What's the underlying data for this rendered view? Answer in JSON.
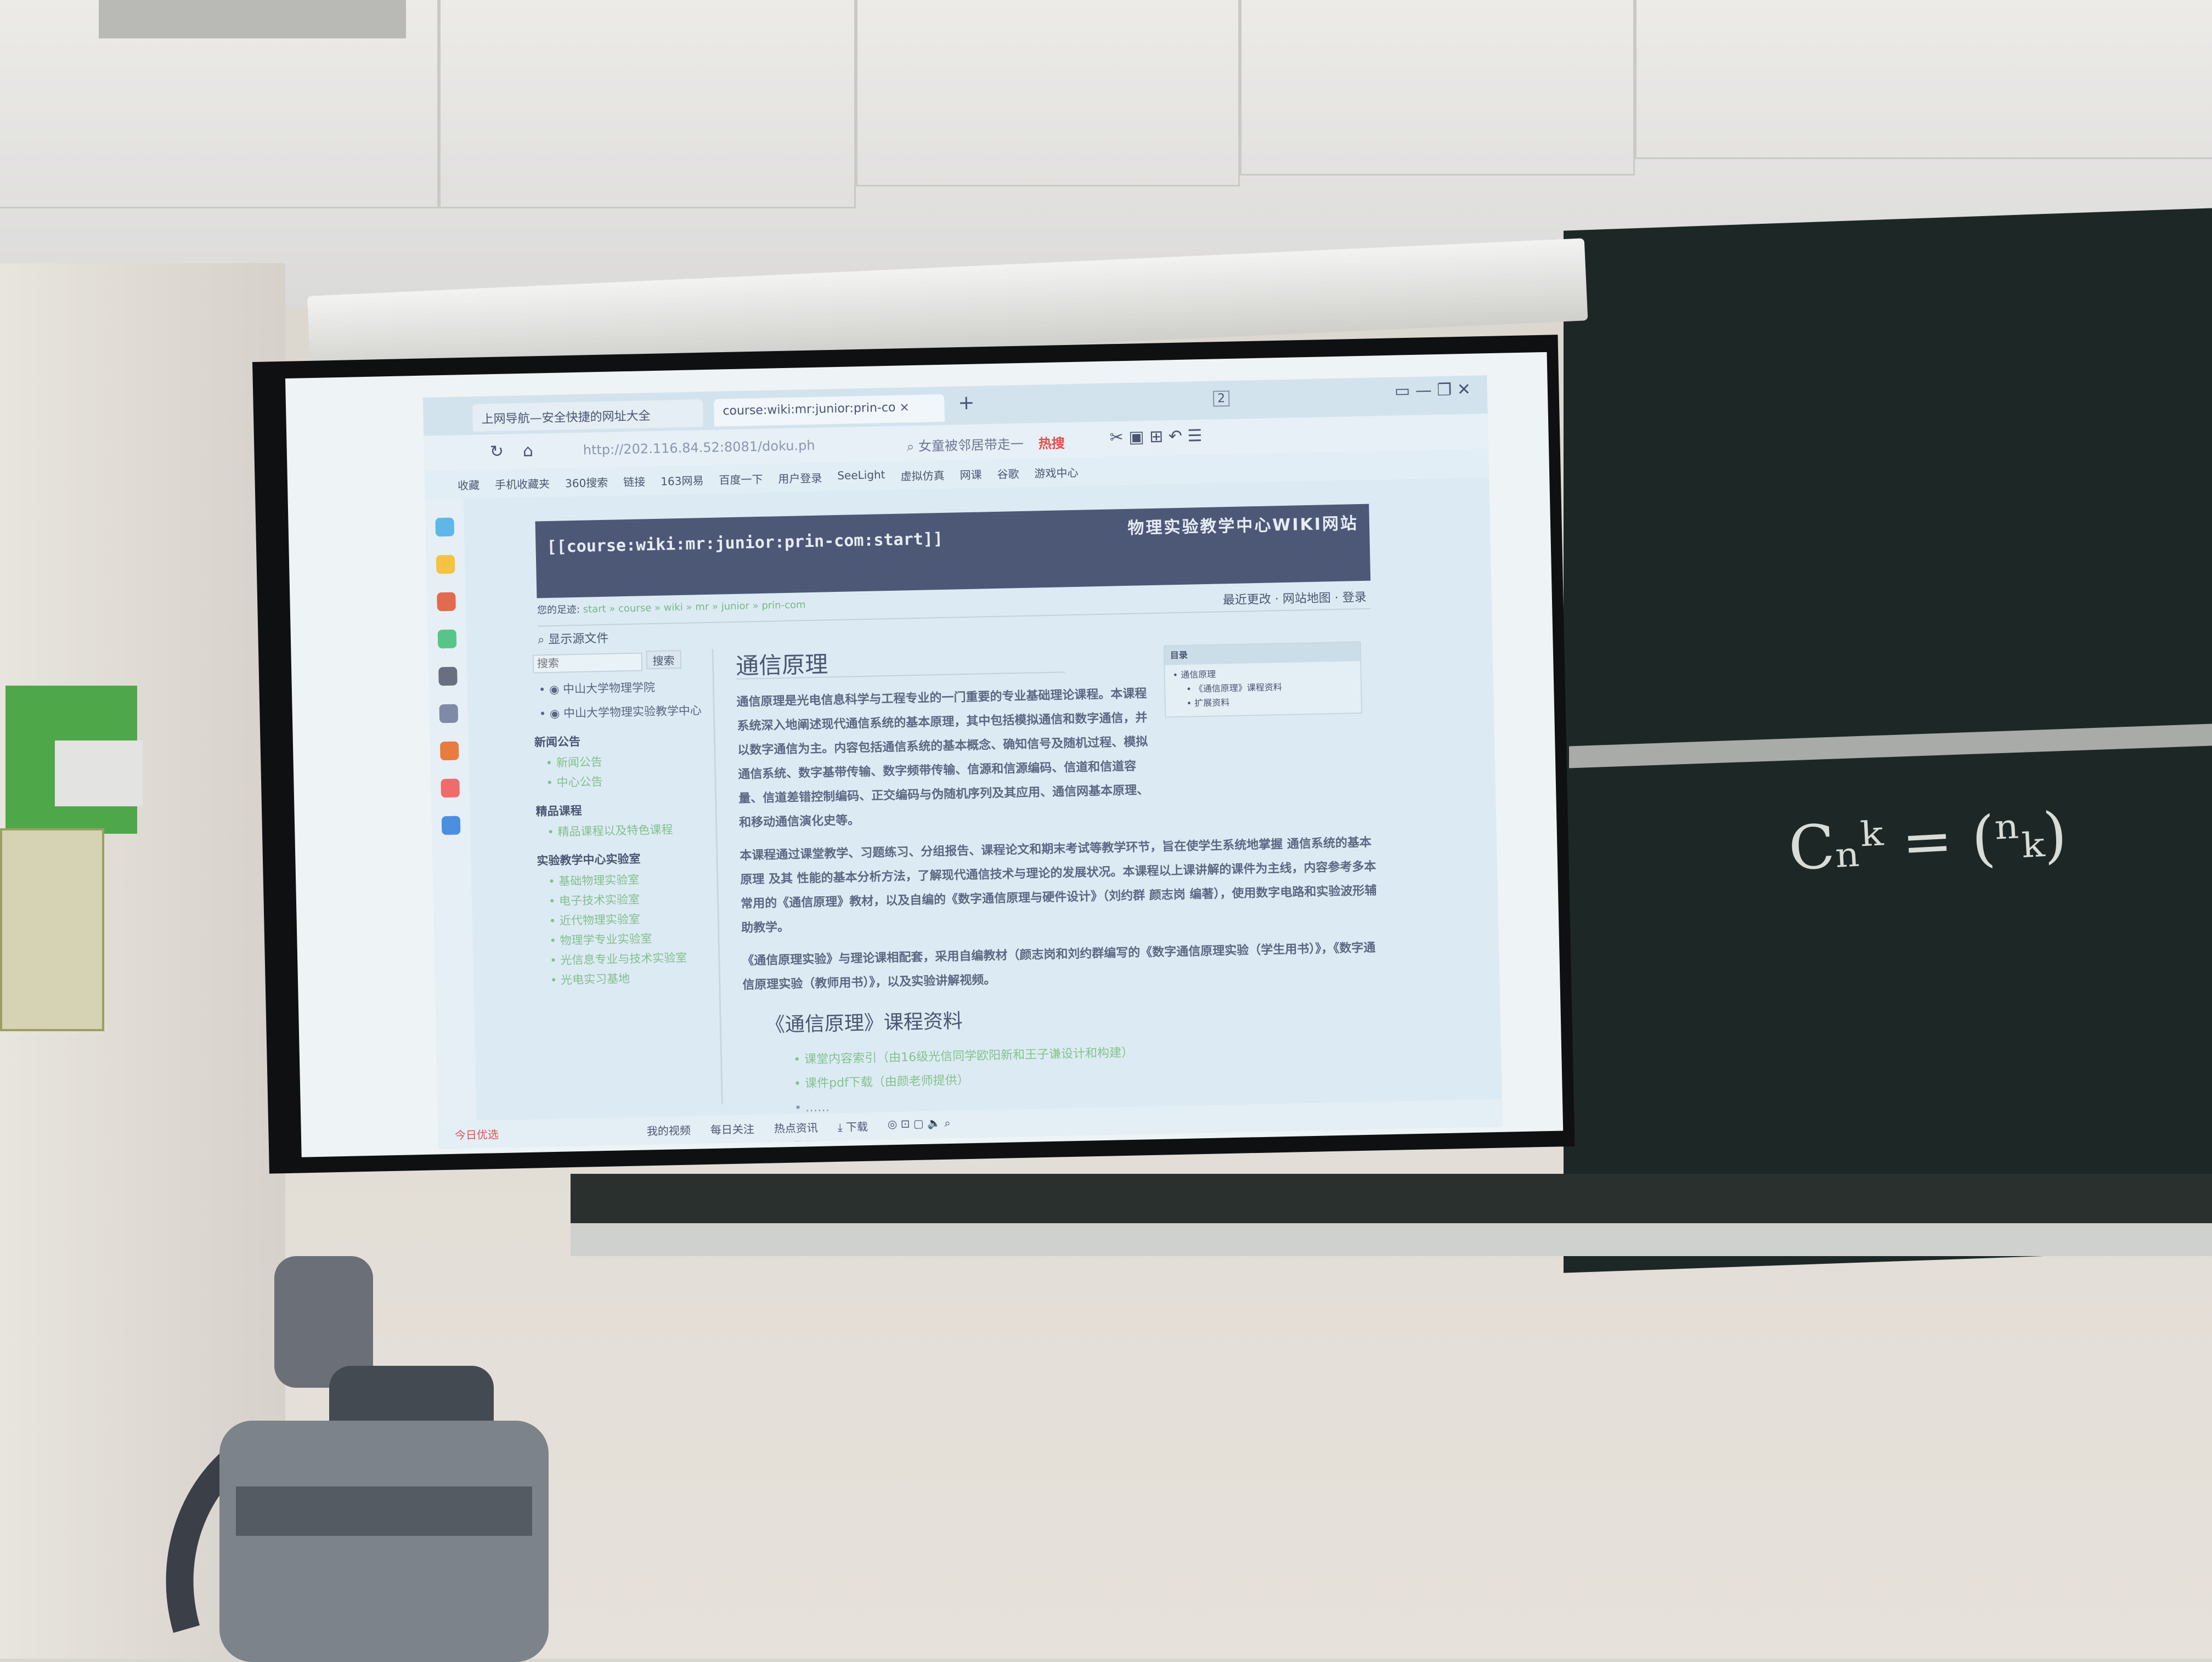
{
  "browser": {
    "tabs": [
      {
        "label": "上网导航—安全快捷的网址大全"
      },
      {
        "label": "course:wiki:mr:junior:prin-co"
      }
    ],
    "new_tab": "+",
    "close_tab": "×",
    "url": "http://202.116.84.52:8081/doku.ph",
    "search_hint": "女童被邻居带走一",
    "hot_label": "热搜",
    "page_counter": "2",
    "bookmarks": [
      "收藏",
      "手机收藏夹",
      "360搜索",
      "链接",
      "163网易",
      "百度一下",
      "用户登录",
      "SeeLight",
      "虚拟仿真",
      "网课",
      "谷歌",
      "游戏中心"
    ]
  },
  "page": {
    "banner_id": "[[course:wiki:mr:junior:prin-com:start]]",
    "banner_site": "物理实验教学中心WIKI网站",
    "breadcrumb_label": "您的足迹:",
    "breadcrumb": "start » course » wiki » mr » junior » prin-com",
    "tools": {
      "recent": "最近更改",
      "sitemap": "网站地图",
      "login": "登录"
    },
    "show_source": "显示源文件",
    "search": {
      "placeholder": "搜索",
      "button": "搜索"
    },
    "nav": {
      "links": [
        "中山大学物理学院",
        "中山大学物理实验教学中心"
      ],
      "sections": [
        {
          "title": "新闻公告",
          "items": [
            "新闻公告",
            "中心公告"
          ]
        },
        {
          "title": "精品课程",
          "items": [
            "精品课程以及特色课程"
          ]
        },
        {
          "title": "实验教学中心实验室",
          "items": [
            "基础物理实验室",
            "电子技术实验室",
            "近代物理实验室",
            "物理学专业实验室",
            "光信息专业与技术实验室",
            "光电实习基地"
          ]
        }
      ]
    },
    "title": "通信原理",
    "paragraphs": [
      "通信原理是光电信息科学与工程专业的一门重要的专业基础理论课程。本课程系统深入地阐述现代通信系统的基本原理，其中包括模拟通信和数字通信，并以数字通信为主。内容包括通信系统的基本概念、确知信号及随机过程、模拟通信系统、数字基带传输、数字频带传输、信源和信源编码、信道和信道容量、信道差错控制编码、正交编码与伪随机序列及其应用、通信网基本原理、和移动通信演化史等。",
      "本课程通过课堂教学、习题练习、分组报告、课程论文和期末考试等教学环节，旨在使学生系统地掌握 通信系统的基本原理 及其 性能的基本分析方法，了解现代通信技术与理论的发展状况。本课程以上课讲解的课件为主线，内容参考多本常用的《通信原理》教材，以及自编的《数字通信原理与硬件设计》（刘约群 颜志岗 编著），使用数字电路和实验波形辅助教学。",
      "《通信原理实验》与理论课相配套，采用自编教材（颜志岗和刘约群编写的《数字通信原理实验（学生用书）》，《数字通信原理实验（教师用书）》，以及实验讲解视频。"
    ],
    "section2": "《通信原理》课程资料",
    "resources": [
      "课堂内容索引（由16级光信同学欧阳新和王子谦设计和构建）",
      "课件pdf下载（由颜老师提供）",
      "……"
    ],
    "section3": "扩展资料",
    "toc": {
      "title": "目录",
      "items": [
        "通信原理",
        "《通信原理》课程资料",
        "扩展资料"
      ]
    }
  },
  "statusbar": {
    "left": "今日优选",
    "items": [
      "我的视频",
      "每日关注",
      "热点资讯",
      "下载"
    ]
  },
  "chalkboard": "Cₙᵏ = (ⁿₖ)"
}
